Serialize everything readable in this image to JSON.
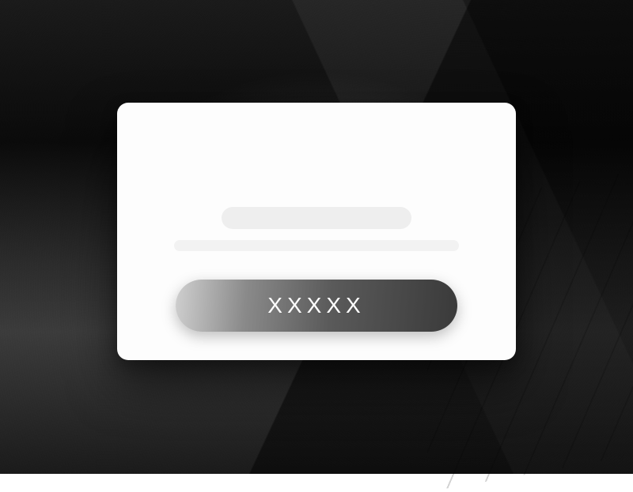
{
  "card": {
    "button_label": "XXXXX"
  }
}
